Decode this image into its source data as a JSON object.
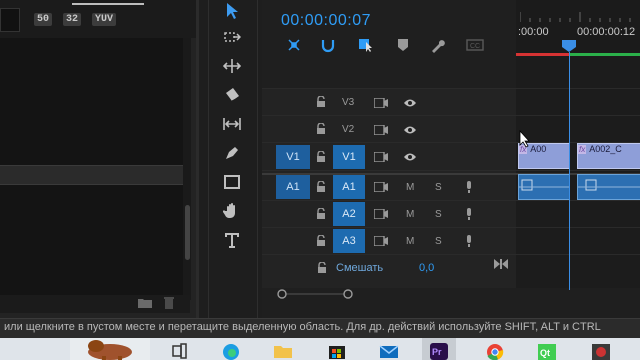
{
  "left_panel": {
    "toolbar_icons": [
      "50",
      "32",
      "YUV"
    ]
  },
  "tools": [
    {
      "name": "selection-tool-icon"
    },
    {
      "name": "track-select-tool-icon"
    },
    {
      "name": "ripple-edit-tool-icon"
    },
    {
      "name": "razor-tool-icon"
    },
    {
      "name": "slip-tool-icon"
    },
    {
      "name": "pen-tool-icon"
    },
    {
      "name": "rectangle-tool-icon"
    },
    {
      "name": "hand-tool-icon"
    },
    {
      "name": "type-tool-icon"
    }
  ],
  "timeline": {
    "timecode": "00:00:00:07",
    "ruler": {
      "start": ":00:00",
      "end": "00:00:00:12"
    },
    "tracks": [
      {
        "id": "V3"
      },
      {
        "id": "V2"
      },
      {
        "id": "V1",
        "source": "V1"
      },
      {
        "id": "A1",
        "source": "A1"
      },
      {
        "id": "A2"
      },
      {
        "id": "A3"
      }
    ],
    "ms": [
      "M",
      "S"
    ],
    "mix": {
      "label": "Смешать",
      "value": "0,0"
    },
    "clips": {
      "video_a": "A00",
      "video_b": "A002_C"
    }
  },
  "status_bar": "или щелкните в пустом месте и перетащите выделенную область. Для др. действий используйте SHIFT, ALT и CTRL",
  "colors": {
    "accent": "#2f9cf5",
    "target": "#1d6bb0",
    "in_out_red": "#d63333",
    "render_green": "#2bb04a"
  },
  "taskbar_apps": [
    "task-view-icon",
    "edge-icon",
    "file-explorer-icon",
    "store-icon",
    "mail-icon",
    "premiere-icon",
    "chrome-icon",
    "qt-icon",
    "other-icon"
  ]
}
